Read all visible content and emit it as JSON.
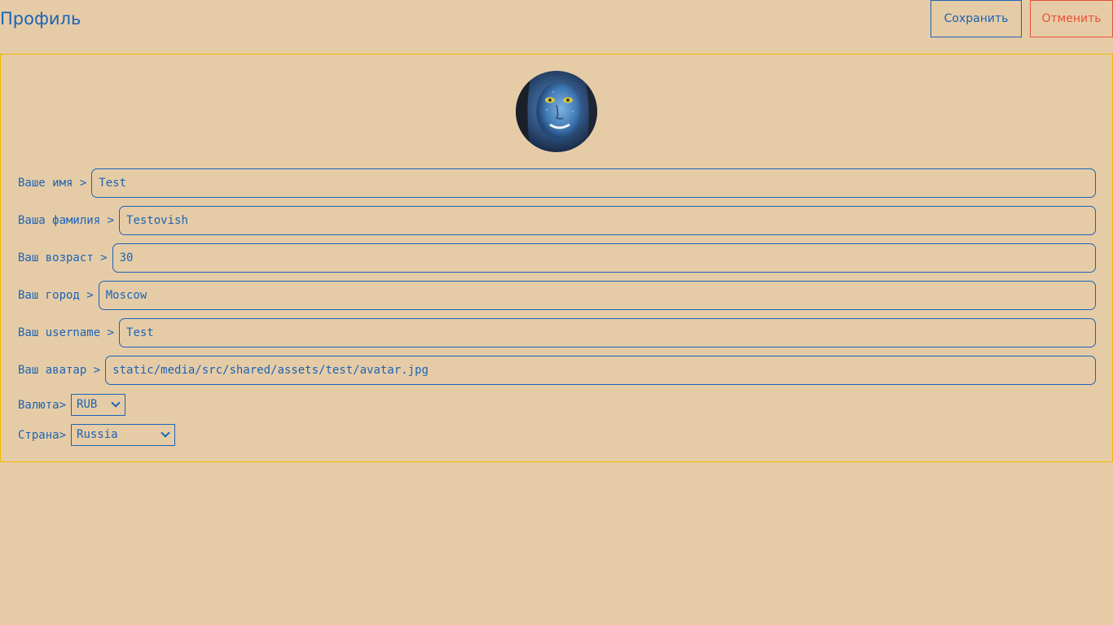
{
  "header": {
    "title": "Профиль",
    "save_label": "Сохранить",
    "cancel_label": "Отменить"
  },
  "profile": {
    "fields": [
      {
        "label": "Ваше имя >",
        "value": "Test"
      },
      {
        "label": "Ваша фамилия >",
        "value": "Testovish"
      },
      {
        "label": "Ваш возраст >",
        "value": "30"
      },
      {
        "label": "Ваш город >",
        "value": "Moscow"
      },
      {
        "label": "Ваш username >",
        "value": "Test"
      },
      {
        "label": "Ваш аватар >",
        "value": "static/media/src/shared/assets/test/avatar.jpg"
      }
    ],
    "currency": {
      "label": "Валюта>",
      "value": "RUB"
    },
    "country": {
      "label": "Страна>",
      "value": "Russia"
    }
  },
  "colors": {
    "background": "#e6cca6",
    "primary": "#1b63b8",
    "danger": "#e8503a",
    "card_border": "#f2b500"
  }
}
